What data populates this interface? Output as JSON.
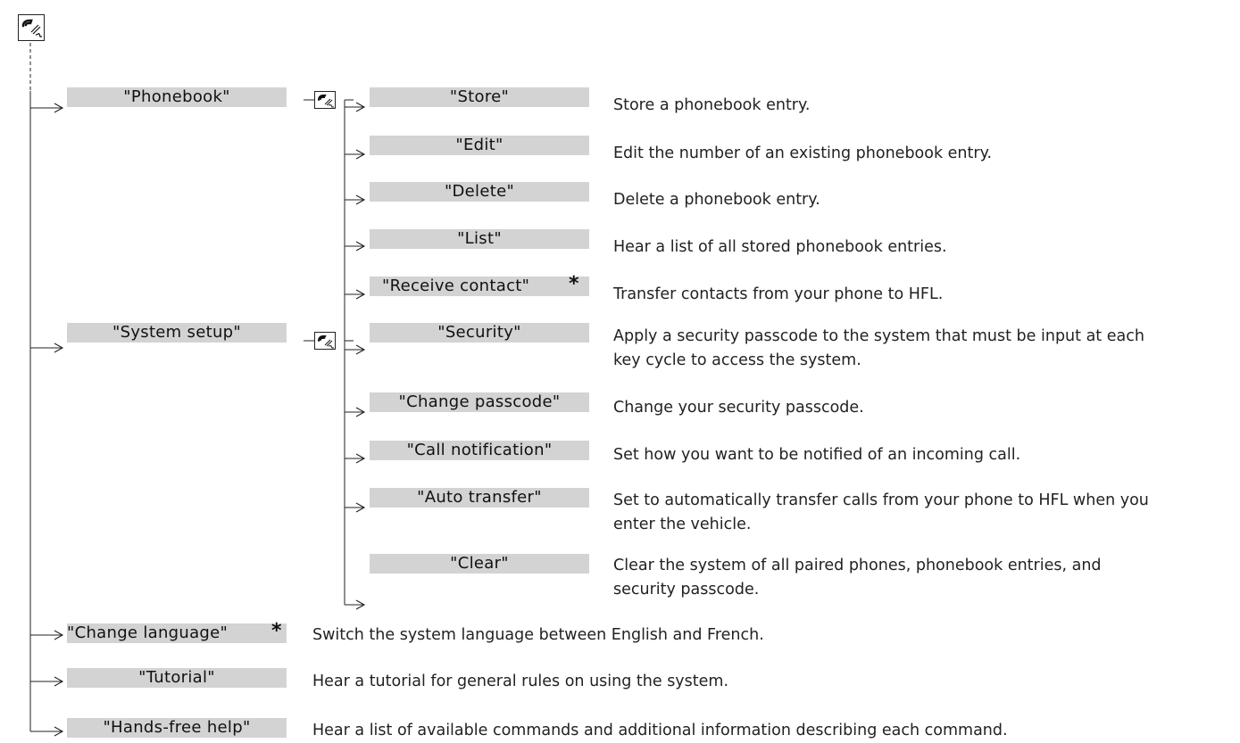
{
  "icons": {
    "talk_button": "talk-button-icon"
  },
  "main_commands": [
    {
      "label": "\"Phonebook\""
    },
    {
      "label": "\"System setup\""
    },
    {
      "label": "\"Change language\"",
      "star": "*",
      "description": "Switch the system language between English and French."
    },
    {
      "label": "\"Tutorial\"",
      "description": "Hear a tutorial for general rules on using the system."
    },
    {
      "label": "\"Hands-free help\"",
      "description": "Hear a list of available commands and additional information describing each command."
    }
  ],
  "phonebook_commands": [
    {
      "label": "\"Store\"",
      "description": "Store a phonebook entry."
    },
    {
      "label": "\"Edit\"",
      "description": "Edit the number of an existing phonebook entry."
    },
    {
      "label": "\"Delete\"",
      "description": "Delete a phonebook entry."
    },
    {
      "label": "\"List\"",
      "description": "Hear a list of all stored phonebook entries."
    },
    {
      "label": "\"Receive contact\"",
      "star": "*",
      "description": "Transfer contacts from your phone to HFL."
    }
  ],
  "system_setup_commands": [
    {
      "label": "\"Security\"",
      "description_line1": "Apply a security passcode to the system that must be input at each",
      "description_line2": "key cycle to access the system."
    },
    {
      "label": "\"Change passcode\"",
      "description_line1": "Change your security passcode."
    },
    {
      "label": "\"Call notification\"",
      "description_line1": "Set how you want to be notified of an incoming call."
    },
    {
      "label": "\"Auto transfer\"",
      "description_line1": "Set to automatically transfer calls from your phone to HFL when you",
      "description_line2": "enter the vehicle."
    },
    {
      "label": "\"Clear\"",
      "description_line1": "Clear the system of all paired phones, phonebook entries, and",
      "description_line2": "security passcode."
    }
  ]
}
